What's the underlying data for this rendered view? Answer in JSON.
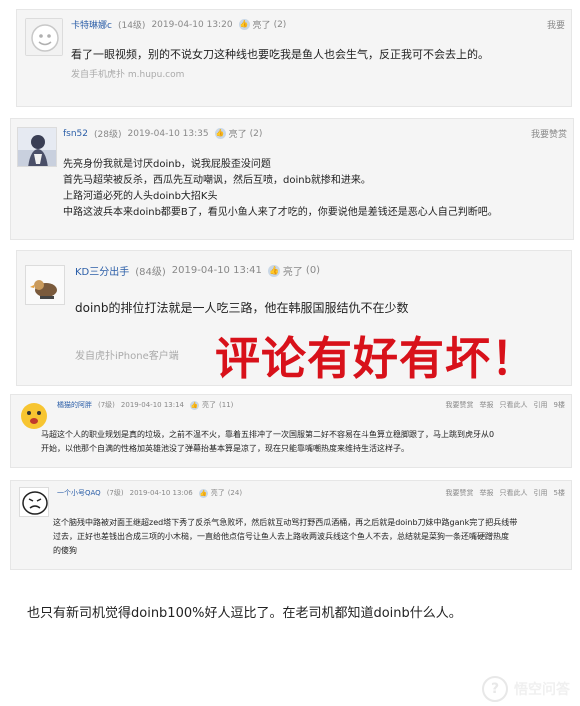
{
  "comments": [
    {
      "user": "卡特琳娜c",
      "level": "(14级)",
      "date": "2019-04-10 13:20",
      "like_label": "亮了",
      "like_count": "(2)",
      "actions": [
        "我要"
      ],
      "lines": [
        "看了一眼视频，别的不说女刀这种线也要吃我是鱼人也会生气，反正我可不会去上的。"
      ],
      "source": "发自手机虎扑 m.hupu.com"
    },
    {
      "user": "fsn52",
      "level": "(28级)",
      "date": "2019-04-10 13:35",
      "like_label": "亮了",
      "like_count": "(2)",
      "actions": [
        "我要赞赏"
      ],
      "lines": [
        "先亮身份我就是讨厌doinb，说我屁股歪没问题",
        "首先马超荣被反杀，西瓜先互动嘲讽，然后互喷，doinb就掺和进来。",
        "上路河道必死的人头doinb大招K头",
        "中路这波兵本来doinb都要B了，看见小鱼人来了才吃的，你要说他是差钱还是恶心人自己判断吧。"
      ],
      "source": ""
    },
    {
      "user": "KD三分出手",
      "level": "(84级)",
      "date": "2019-04-10 13:41",
      "like_label": "亮了",
      "like_count": "(0)",
      "actions": [],
      "lines": [
        "doinb的排位打法就是一人吃三路，他在韩服国服结仇不在少数"
      ],
      "source": "发自虎扑iPhone客户端"
    },
    {
      "user": "橘猫的阿胖",
      "level": "(7级)",
      "date": "2019-04-10 13:14",
      "like_label": "亮了",
      "like_count": "(11)",
      "actions": [
        "我要赞赏",
        "举报",
        "只看此人",
        "引用",
        "9楼"
      ],
      "lines": [
        "马超这个人的职业规划是真的垃圾，之前不温不火，靠着五排冲了一次国服第二好不容易在斗鱼算立稳脚跟了，马上跳到虎牙从0",
        "开始，以他那个自满的性格加英雄池没了弹幕抬基本算是凉了，现在只能靠嘴嘲热度来维持生活这样子。"
      ],
      "source": ""
    },
    {
      "user": "一个小号QAQ",
      "level": "(7级)",
      "date": "2019-04-10 13:06",
      "like_label": "亮了",
      "like_count": "(24)",
      "actions": [
        "我要赞赏",
        "举报",
        "只看此人",
        "引用",
        "5楼"
      ],
      "lines": [
        "这个脑残中路被对面王继超zed塔下秀了反杀气急败坏，然后就互动骂打野西瓜酒桶，再之后就是doinb刀妹中路gank完了把兵线带",
        "过去，正好也差钱出合成三项的小木槌，一直给他点信号让鱼人去上路收两波兵线这个鱼人不去，总结就是菜狗一条还嘴硬蹭热度",
        "的傻狗"
      ],
      "source": ""
    }
  ],
  "overlay_text": "评论有好有坏！",
  "bottom_text": "也只有新司机觉得doinb100%好人逗比了。在老司机都知道doinb什么人。",
  "watermark": "悟空问答",
  "colors": {
    "overlay": "#d8111a",
    "username": "#2b5ea8",
    "card_bg": "#f5f5f5"
  }
}
